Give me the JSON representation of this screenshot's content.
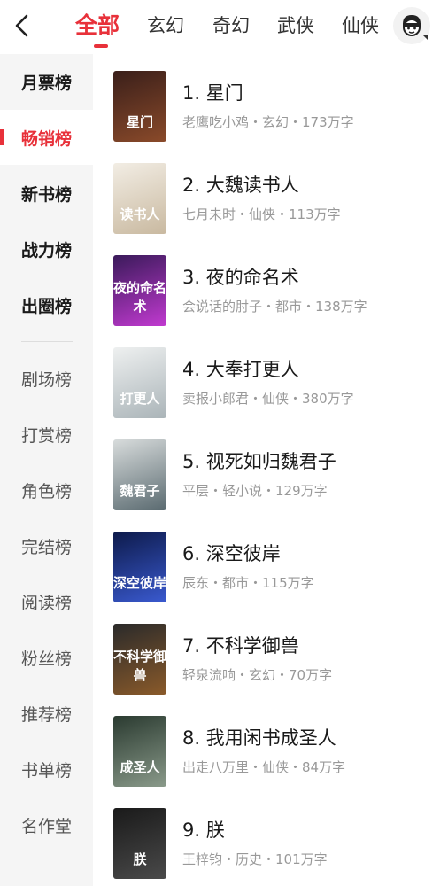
{
  "header": {
    "tabs": [
      {
        "label": "全部",
        "active": true
      },
      {
        "label": "玄幻"
      },
      {
        "label": "奇幻"
      },
      {
        "label": "武侠"
      },
      {
        "label": "仙侠"
      }
    ],
    "back_icon": "chevron-left-icon",
    "avatar_icon": "user-avatar-icon",
    "accent_color": "#e8313a"
  },
  "sidebar": {
    "items": [
      {
        "label": "月票榜"
      },
      {
        "label": "畅销榜",
        "active": true
      },
      {
        "label": "新书榜"
      },
      {
        "label": "战力榜"
      },
      {
        "label": "出圈榜"
      },
      {
        "label": "剧场榜"
      },
      {
        "label": "打赏榜"
      },
      {
        "label": "角色榜"
      },
      {
        "label": "完结榜"
      },
      {
        "label": "阅读榜"
      },
      {
        "label": "粉丝榜"
      },
      {
        "label": "推荐榜"
      },
      {
        "label": "书单榜"
      },
      {
        "label": "名作堂"
      }
    ]
  },
  "books": [
    {
      "title": "1. 星门",
      "meta": "老鹰吃小鸡・玄幻・173万字",
      "cover_text": "星门",
      "cover_colors": [
        "#3a1f1a",
        "#8a4a2a"
      ]
    },
    {
      "title": "2. 大魏读书人",
      "meta": "七月未时・仙侠・113万字",
      "cover_text": "读书人",
      "cover_colors": [
        "#f2ede4",
        "#c9b9a0"
      ]
    },
    {
      "title": "3. 夜的命名术",
      "meta": "会说话的肘子・都市・138万字",
      "cover_text": "夜的命名术",
      "cover_colors": [
        "#3a1a5a",
        "#c13ad0"
      ]
    },
    {
      "title": "4. 大奉打更人",
      "meta": "卖报小郎君・仙侠・380万字",
      "cover_text": "打更人",
      "cover_colors": [
        "#eef0f0",
        "#aab4b8"
      ]
    },
    {
      "title": "5. 视死如归魏君子",
      "meta": "平层・轻小说・129万字",
      "cover_text": "魏君子",
      "cover_colors": [
        "#d8dcdc",
        "#5a6a70"
      ]
    },
    {
      "title": "6. 深空彼岸",
      "meta": "辰东・都市・115万字",
      "cover_text": "深空彼岸",
      "cover_colors": [
        "#0d1a4a",
        "#3a5ad0"
      ]
    },
    {
      "title": "7. 不科学御兽",
      "meta": "轻泉流响・玄幻・70万字",
      "cover_text": "不科学御兽",
      "cover_colors": [
        "#2a2a2a",
        "#8a5a2a"
      ]
    },
    {
      "title": "8. 我用闲书成圣人",
      "meta": "出走八万里・仙侠・84万字",
      "cover_text": "成圣人",
      "cover_colors": [
        "#2a3a30",
        "#8a9a8a"
      ]
    },
    {
      "title": "9. 朕",
      "meta": "王梓钧・历史・101万字",
      "cover_text": "朕",
      "cover_colors": [
        "#1a1a1a",
        "#4a4a4a"
      ]
    }
  ]
}
